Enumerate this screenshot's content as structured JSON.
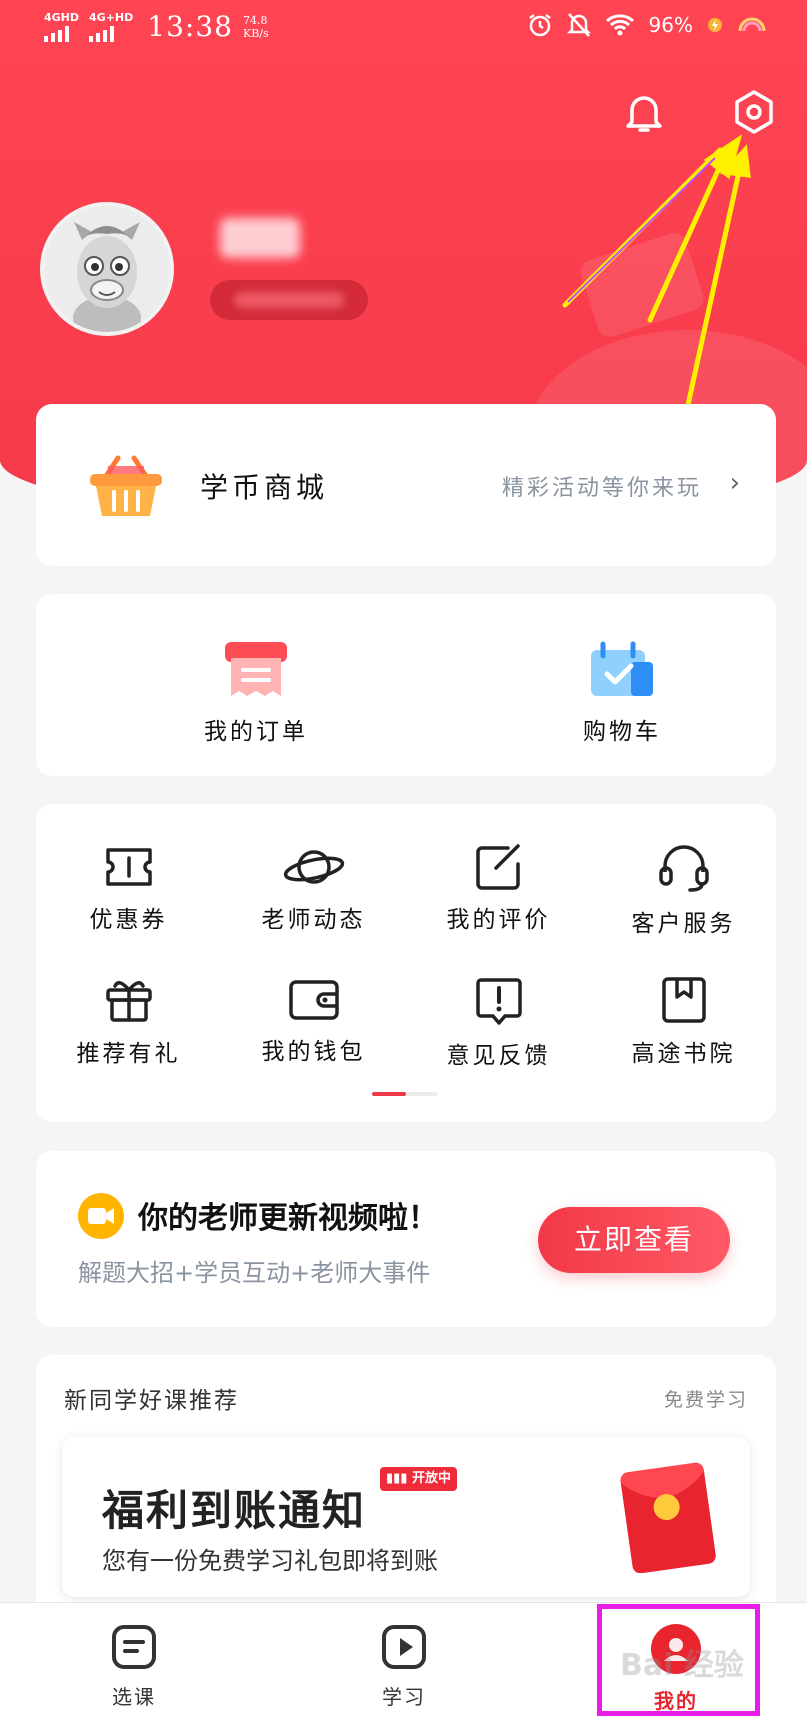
{
  "status_bar": {
    "net1": "4GHD",
    "net2": "4G+HD",
    "time": "13:38",
    "speed_value": "74.8",
    "speed_unit": "KB/s",
    "battery": "96%"
  },
  "header": {
    "bell_icon": "bell-icon",
    "settings_icon": "hexagon-gear-icon"
  },
  "mall": {
    "title": "学币商城",
    "subtitle": "精彩活动等你来玩",
    "chevron": "›"
  },
  "orders": [
    {
      "label": "我的订单",
      "icon": "order-icon"
    },
    {
      "label": "购物车",
      "icon": "cart-icon"
    }
  ],
  "services": [
    {
      "label": "优惠券",
      "icon": "coupon-icon"
    },
    {
      "label": "老师动态",
      "icon": "planet-icon"
    },
    {
      "label": "我的评价",
      "icon": "edit-icon"
    },
    {
      "label": "客户服务",
      "icon": "headset-icon"
    },
    {
      "label": "推荐有礼",
      "icon": "gift-icon"
    },
    {
      "label": "我的钱包",
      "icon": "wallet-icon"
    },
    {
      "label": "意见反馈",
      "icon": "feedback-icon"
    },
    {
      "label": "高途书院",
      "icon": "book-icon"
    }
  ],
  "promo": {
    "title": "你的老师更新视频啦！",
    "subtitle": "解题大招+学员互动+老师大事件",
    "button": "立即查看"
  },
  "recommend": {
    "title": "新同学好课推荐",
    "more": "免费学习",
    "banner_title": "福利到账通知",
    "banner_badge": "开放中",
    "banner_sub": "您有一份免费学习礼包即将到账"
  },
  "bottom_nav": [
    {
      "label": "选课",
      "icon": "course-icon",
      "active": false
    },
    {
      "label": "学习",
      "icon": "play-icon",
      "active": false
    },
    {
      "label": "我的",
      "icon": "profile-icon",
      "active": true
    }
  ],
  "watermark": "Bai 经验"
}
